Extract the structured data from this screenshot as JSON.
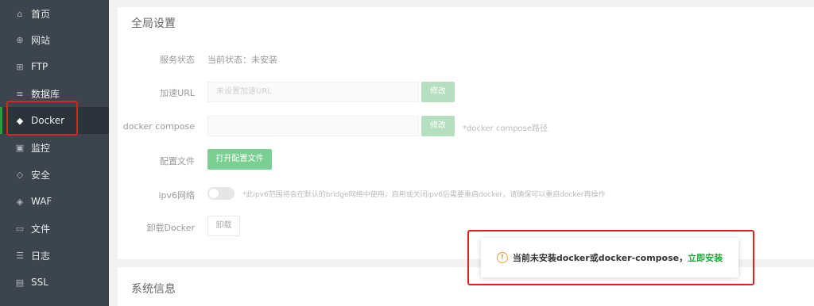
{
  "sidebar": {
    "items": [
      {
        "label": "首页",
        "icon": "home-icon",
        "glyph": "⌂"
      },
      {
        "label": "网站",
        "icon": "globe-icon",
        "glyph": "⊕"
      },
      {
        "label": "FTP",
        "icon": "ftp-icon",
        "glyph": "⊞"
      },
      {
        "label": "数据库",
        "icon": "database-icon",
        "glyph": "≡"
      },
      {
        "label": "Docker",
        "icon": "docker-icon",
        "glyph": "◆"
      },
      {
        "label": "监控",
        "icon": "monitor-icon",
        "glyph": "▣"
      },
      {
        "label": "安全",
        "icon": "shield-icon",
        "glyph": "◇"
      },
      {
        "label": "WAF",
        "icon": "waf-icon",
        "glyph": "◈"
      },
      {
        "label": "文件",
        "icon": "folder-icon",
        "glyph": "▭"
      },
      {
        "label": "日志",
        "icon": "log-icon",
        "glyph": "☰"
      },
      {
        "label": "SSL",
        "icon": "ssl-icon",
        "glyph": "▤"
      }
    ],
    "active": "Docker"
  },
  "global": {
    "title": "全局设置",
    "service_status_label": "服务状态",
    "service_status_value": "当前状态：未安装",
    "accel_url_label": "加速URL",
    "accel_url_placeholder": "未设置加速URL",
    "modify_label": "修改",
    "compose_label": "docker compose",
    "compose_modify_label": "修改",
    "compose_hint": "*docker compose路径",
    "config_file_label": "配置文件",
    "open_config_label": "打开配置文件",
    "ipv6_label": "ipv6网络",
    "ipv6_hint": "*此ipv6范围将会在默认的bridge网络中使用，启用或关闭ipv6后需要重启docker，请确保可以重启docker再操作",
    "uninstall_label": "卸载Docker",
    "uninstall_button": "卸载"
  },
  "system": {
    "title": "系统信息"
  },
  "toast": {
    "message": "当前未安装docker或docker-compose，",
    "link": "立即安装"
  },
  "colors": {
    "sidebar_bg": "#3c444d",
    "accent": "#20a53a",
    "highlight": "#e02020",
    "warning": "#e6a23c"
  }
}
